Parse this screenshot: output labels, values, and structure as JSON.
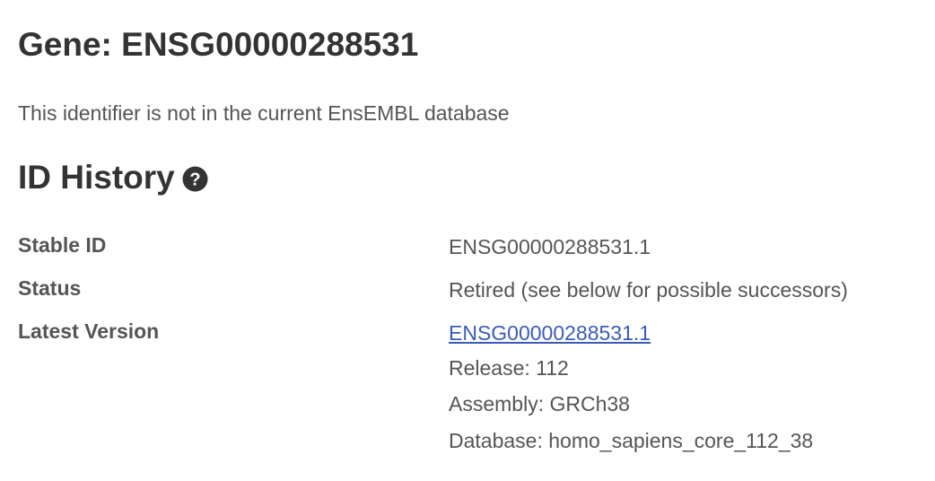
{
  "page": {
    "title": "Gene: ENSG00000288531",
    "notice": "This identifier is not in the current EnsEMBL database"
  },
  "id_history": {
    "heading": "ID History",
    "help_icon": "question-circle-icon",
    "rows": {
      "stable_id": {
        "label": "Stable ID",
        "value": "ENSG00000288531.1"
      },
      "status": {
        "label": "Status",
        "value": "Retired (see below for possible successors)"
      },
      "latest_version": {
        "label": "Latest Version",
        "link": "ENSG00000288531.1",
        "release": "Release: 112",
        "assembly": "Assembly: GRCh38",
        "database": "Database: homo_sapiens_core_112_38"
      }
    }
  },
  "colors": {
    "text": "#333333",
    "secondary_text": "#555555",
    "link": "#3b5cb5"
  }
}
